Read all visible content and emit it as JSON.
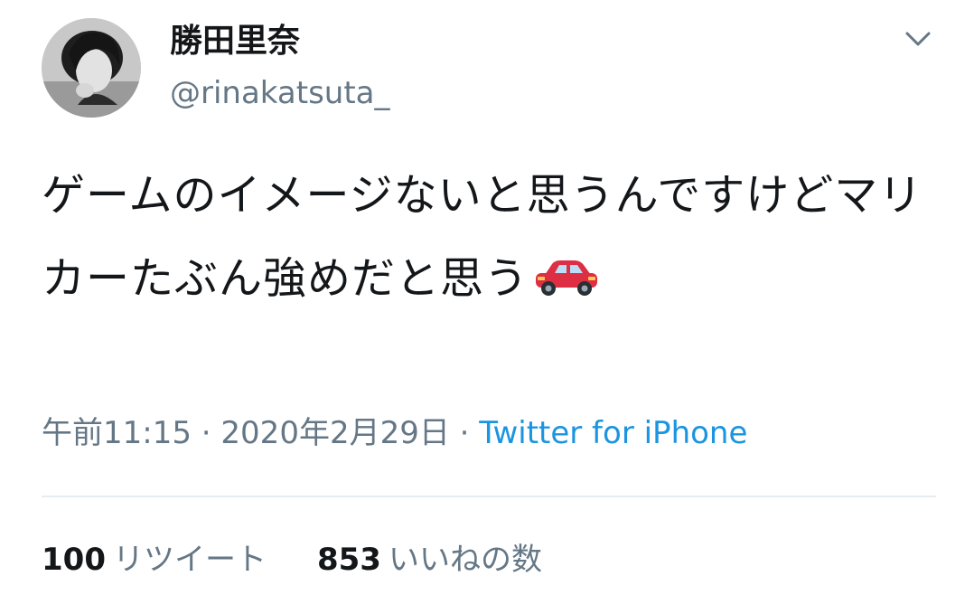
{
  "author": {
    "display_name": "勝田里奈",
    "handle": "@rinakatsuta_"
  },
  "tweet": {
    "text": "ゲームのイメージないと思うんですけどマリカーたぶん強めだと思う",
    "emoji_icon": "red-car-icon"
  },
  "meta": {
    "time": "午前11:15",
    "separator": " · ",
    "date": "2020年2月29日",
    "separator2": " · ",
    "source": "Twitter for iPhone"
  },
  "stats": {
    "retweets_count": "100",
    "retweets_label": "リツイート",
    "likes_count": "853",
    "likes_label": "いいねの数"
  },
  "colors": {
    "text": "#14171a",
    "secondary": "#657786",
    "link": "#1b95e0",
    "divider": "#e6ecf0"
  },
  "icons": {
    "menu": "chevron-down-icon"
  }
}
